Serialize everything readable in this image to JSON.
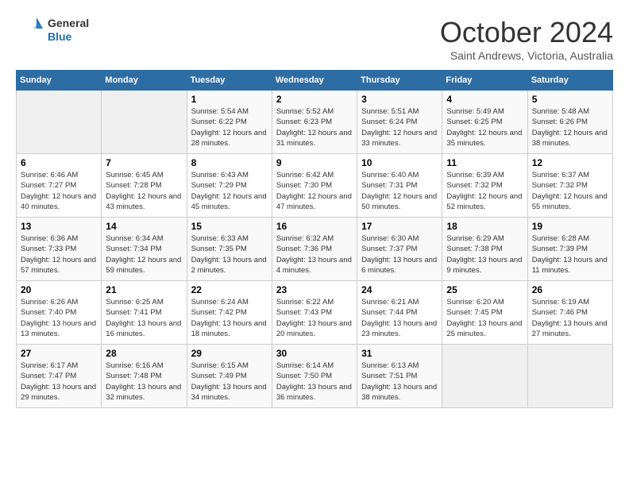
{
  "logo": {
    "line1": "General",
    "line2": "Blue"
  },
  "title": "October 2024",
  "subtitle": "Saint Andrews, Victoria, Australia",
  "days_of_week": [
    "Sunday",
    "Monday",
    "Tuesday",
    "Wednesday",
    "Thursday",
    "Friday",
    "Saturday"
  ],
  "weeks": [
    [
      {
        "day": "",
        "info": ""
      },
      {
        "day": "",
        "info": ""
      },
      {
        "day": "1",
        "info": "Sunrise: 5:54 AM\nSunset: 6:22 PM\nDaylight: 12 hours and 28 minutes."
      },
      {
        "day": "2",
        "info": "Sunrise: 5:52 AM\nSunset: 6:23 PM\nDaylight: 12 hours and 31 minutes."
      },
      {
        "day": "3",
        "info": "Sunrise: 5:51 AM\nSunset: 6:24 PM\nDaylight: 12 hours and 33 minutes."
      },
      {
        "day": "4",
        "info": "Sunrise: 5:49 AM\nSunset: 6:25 PM\nDaylight: 12 hours and 35 minutes."
      },
      {
        "day": "5",
        "info": "Sunrise: 5:48 AM\nSunset: 6:26 PM\nDaylight: 12 hours and 38 minutes."
      }
    ],
    [
      {
        "day": "6",
        "info": "Sunrise: 6:46 AM\nSunset: 7:27 PM\nDaylight: 12 hours and 40 minutes."
      },
      {
        "day": "7",
        "info": "Sunrise: 6:45 AM\nSunset: 7:28 PM\nDaylight: 12 hours and 43 minutes."
      },
      {
        "day": "8",
        "info": "Sunrise: 6:43 AM\nSunset: 7:29 PM\nDaylight: 12 hours and 45 minutes."
      },
      {
        "day": "9",
        "info": "Sunrise: 6:42 AM\nSunset: 7:30 PM\nDaylight: 12 hours and 47 minutes."
      },
      {
        "day": "10",
        "info": "Sunrise: 6:40 AM\nSunset: 7:31 PM\nDaylight: 12 hours and 50 minutes."
      },
      {
        "day": "11",
        "info": "Sunrise: 6:39 AM\nSunset: 7:32 PM\nDaylight: 12 hours and 52 minutes."
      },
      {
        "day": "12",
        "info": "Sunrise: 6:37 AM\nSunset: 7:32 PM\nDaylight: 12 hours and 55 minutes."
      }
    ],
    [
      {
        "day": "13",
        "info": "Sunrise: 6:36 AM\nSunset: 7:33 PM\nDaylight: 12 hours and 57 minutes."
      },
      {
        "day": "14",
        "info": "Sunrise: 6:34 AM\nSunset: 7:34 PM\nDaylight: 12 hours and 59 minutes."
      },
      {
        "day": "15",
        "info": "Sunrise: 6:33 AM\nSunset: 7:35 PM\nDaylight: 13 hours and 2 minutes."
      },
      {
        "day": "16",
        "info": "Sunrise: 6:32 AM\nSunset: 7:36 PM\nDaylight: 13 hours and 4 minutes."
      },
      {
        "day": "17",
        "info": "Sunrise: 6:30 AM\nSunset: 7:37 PM\nDaylight: 13 hours and 6 minutes."
      },
      {
        "day": "18",
        "info": "Sunrise: 6:29 AM\nSunset: 7:38 PM\nDaylight: 13 hours and 9 minutes."
      },
      {
        "day": "19",
        "info": "Sunrise: 6:28 AM\nSunset: 7:39 PM\nDaylight: 13 hours and 11 minutes."
      }
    ],
    [
      {
        "day": "20",
        "info": "Sunrise: 6:26 AM\nSunset: 7:40 PM\nDaylight: 13 hours and 13 minutes."
      },
      {
        "day": "21",
        "info": "Sunrise: 6:25 AM\nSunset: 7:41 PM\nDaylight: 13 hours and 16 minutes."
      },
      {
        "day": "22",
        "info": "Sunrise: 6:24 AM\nSunset: 7:42 PM\nDaylight: 13 hours and 18 minutes."
      },
      {
        "day": "23",
        "info": "Sunrise: 6:22 AM\nSunset: 7:43 PM\nDaylight: 13 hours and 20 minutes."
      },
      {
        "day": "24",
        "info": "Sunrise: 6:21 AM\nSunset: 7:44 PM\nDaylight: 13 hours and 23 minutes."
      },
      {
        "day": "25",
        "info": "Sunrise: 6:20 AM\nSunset: 7:45 PM\nDaylight: 13 hours and 25 minutes."
      },
      {
        "day": "26",
        "info": "Sunrise: 6:19 AM\nSunset: 7:46 PM\nDaylight: 13 hours and 27 minutes."
      }
    ],
    [
      {
        "day": "27",
        "info": "Sunrise: 6:17 AM\nSunset: 7:47 PM\nDaylight: 13 hours and 29 minutes."
      },
      {
        "day": "28",
        "info": "Sunrise: 6:16 AM\nSunset: 7:48 PM\nDaylight: 13 hours and 32 minutes."
      },
      {
        "day": "29",
        "info": "Sunrise: 6:15 AM\nSunset: 7:49 PM\nDaylight: 13 hours and 34 minutes."
      },
      {
        "day": "30",
        "info": "Sunrise: 6:14 AM\nSunset: 7:50 PM\nDaylight: 13 hours and 36 minutes."
      },
      {
        "day": "31",
        "info": "Sunrise: 6:13 AM\nSunset: 7:51 PM\nDaylight: 13 hours and 38 minutes."
      },
      {
        "day": "",
        "info": ""
      },
      {
        "day": "",
        "info": ""
      }
    ]
  ]
}
